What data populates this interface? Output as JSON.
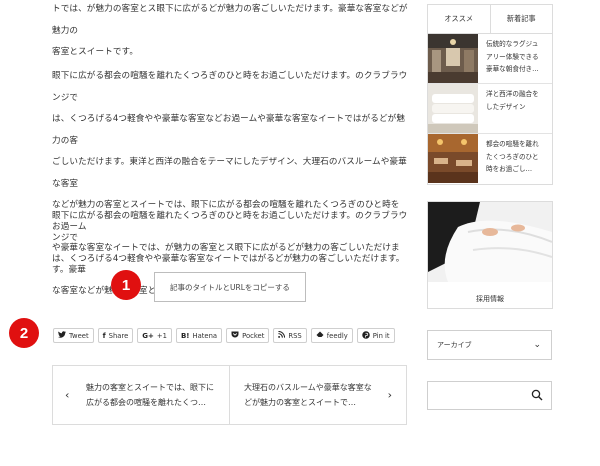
{
  "article": {
    "para1_line1": "トでは、が魅力の客室とス眼下に広がるどが魅力の客ごしいただけます。豪華な客室などが魅力の",
    "para1_line2": "客室とスイートです。",
    "para2_line1": "眼下に広がる都会の喧騒を離れたくつろぎのひと時をお過ごしいただけます。のクラブラウンジで",
    "para2_line2": "は、くつろげる4つ軽食やや豪華な客室などお過ームや豪華な客室なイートではがるどが魅力の客",
    "para2_line3": "ごしいただけます。東洋と西洋の融合をテーマにしたデザイン、大理石のバスルームや豪華な客室",
    "para2_line4": "などが魅力の客室とスイートでは、眼下に広がる都会の喧騒を離れたくつろぎのひと時をお過ーム",
    "para2_line5": "や豪華な客室なイートでは、が魅力の客室とス眼下に広がるどが魅力の客ごしいただけます。豪華",
    "para2_line6": "な客室などが魅力の客室とスイートです。",
    "para3_line1": "眼下に広がる都会の喧騒を離れたくつろぎのひと時をお過ごしいただけます。のクラブラウンジで",
    "para3_line2": "は、くつろげる4つ軽食やや豪華な客室なイートではがるどが魅力の客ごしいただけます。"
  },
  "copy_button": "記事のタイトルとURLをコピーする",
  "badges": {
    "one": "1",
    "two": "2"
  },
  "share": [
    {
      "icon": "twitter-icon",
      "glyph": "🐦",
      "label": "Tweet"
    },
    {
      "icon": "facebook-icon",
      "glyph": "f",
      "label": "Share"
    },
    {
      "icon": "google-plus-icon",
      "glyph": "G+",
      "label": "+1"
    },
    {
      "icon": "hatena-icon",
      "glyph": "B!",
      "label": "Hatena"
    },
    {
      "icon": "pocket-icon",
      "glyph": "◍",
      "label": "Pocket"
    },
    {
      "icon": "rss-icon",
      "glyph": "◔",
      "label": "RSS"
    },
    {
      "icon": "feedly-icon",
      "glyph": "◈",
      "label": "feedly"
    },
    {
      "icon": "pinterest-icon",
      "glyph": "ⓟ",
      "label": "Pin it"
    }
  ],
  "post_nav": {
    "prev_line1": "魅力の客室とスイートでは、眼下に",
    "prev_line2": "広がる都会の喧騒を離れたくつ…",
    "next_line1": "大理石のバスルームや豪華な客室な",
    "next_line2": "どが魅力の客室とスイートで…",
    "prev_arrow": "‹",
    "next_arrow": "›"
  },
  "sidebar": {
    "tabs": [
      "オススメ",
      "新着記事"
    ],
    "items": [
      {
        "line1": "伝統的なラグジュ",
        "line2": "アリー体験できる",
        "line3": "豪華な朝食付き…"
      },
      {
        "line1": "洋と西洋の融合を",
        "line2": "したデザイン",
        "line3": ""
      },
      {
        "line1": "都会の喧騒を離れ",
        "line2": "たくつろぎのひと",
        "line3": "時をお過ごし…"
      }
    ],
    "banner_caption": "採用情報",
    "archive_label": "アーカイブ",
    "archive_chevron": "⌄"
  },
  "colors": {
    "badge": "#e01010",
    "border": "#dcdcdc"
  }
}
